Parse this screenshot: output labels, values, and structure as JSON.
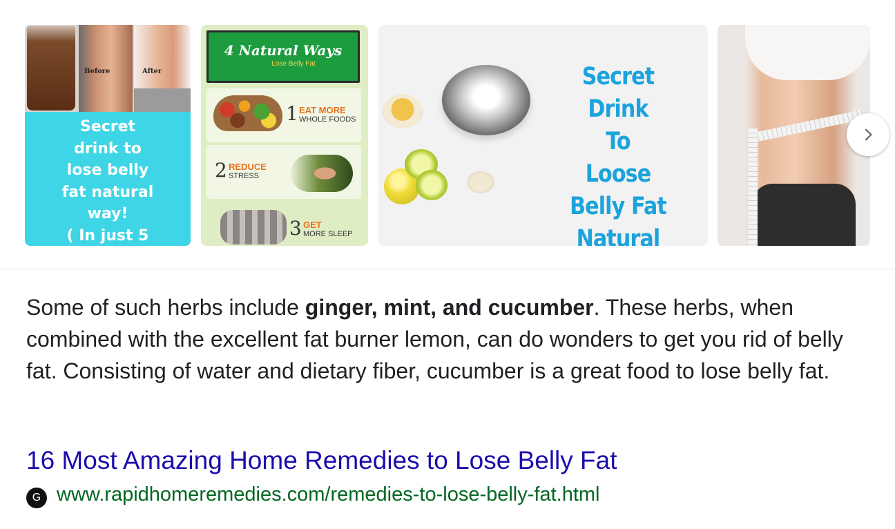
{
  "carousel": {
    "thumb1": {
      "tag_before": "Before",
      "tag_after": "After",
      "caption_lines": [
        "Secret",
        "drink to",
        "lose belly",
        "fat natural",
        "way!",
        "( In just 5"
      ]
    },
    "thumb2": {
      "banner_title": "4 Natural Ways",
      "banner_sub": "Lose Belly Fat",
      "items": [
        {
          "num": "1",
          "top": "EAT MORE",
          "bottom": "WHOLE FOODS"
        },
        {
          "num": "2",
          "top": "REDUCE",
          "bottom": "STRESS"
        },
        {
          "num": "3",
          "top": "GET",
          "bottom": "MORE SLEEP"
        }
      ]
    },
    "thumb3": {
      "headline_lines": [
        "Secret Drink",
        "To",
        "Loose",
        "Belly Fat",
        "Natural Way"
      ]
    },
    "next_icon": "chevron-right-icon"
  },
  "snippet": {
    "before_bold": "Some of such herbs include ",
    "bold": "ginger, mint, and cucumber",
    "after_bold": ". These herbs, when combined with the excellent fat burner lemon, can do wonders to get you rid of belly fat. Consisting of water and dietary fiber, cucumber is a great food to lose belly fat."
  },
  "result": {
    "title": "16 Most Amazing Home Remedies to Lose Belly Fat",
    "favicon_letter": "G",
    "url": "www.rapidhomeremedies.com/remedies-to-lose-belly-fat.html"
  },
  "colors": {
    "link": "#1a0dab",
    "url": "#006621",
    "text": "#202124",
    "cyan": "#3ed5e6",
    "headline_blue": "#1aa3dc",
    "accent_orange": "#e8711a"
  }
}
